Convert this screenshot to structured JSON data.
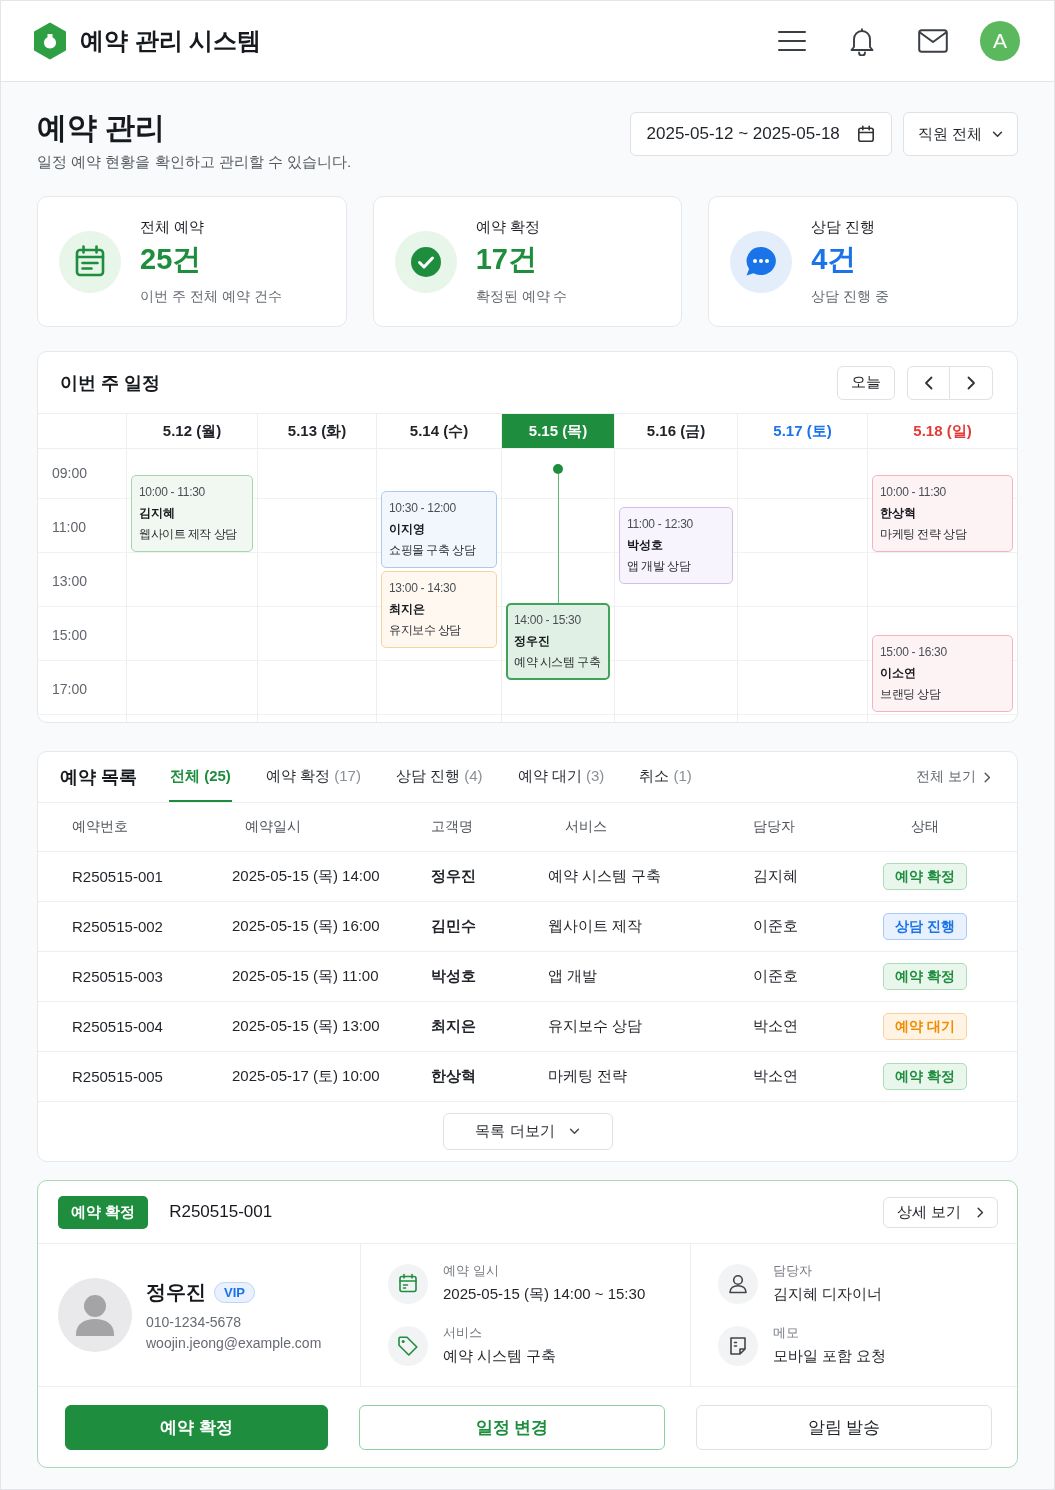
{
  "header": {
    "title": "예약 관리 시스템",
    "user_initial": "A"
  },
  "page": {
    "title": "예약 관리",
    "subtitle": "일정 예약 현황을 확인하고 관리할 수 있습니다.",
    "date_range": "2025-05-12 ~ 2025-05-18",
    "staff_filter": "직원 전체"
  },
  "stats": [
    {
      "kind": "total",
      "label": "전체 예약",
      "value": "25건",
      "description": "이번 주 전체 예약 건수"
    },
    {
      "kind": "confirmed",
      "label": "예약 확정",
      "value": "17건",
      "description": "확정된 예약 수"
    },
    {
      "kind": "consulting",
      "label": "상담 진행",
      "value": "4건",
      "description": "상담 진행 중"
    }
  ],
  "schedule": {
    "title": "이번 주 일정",
    "today_button": "오늘",
    "times": [
      "09:00",
      "11:00",
      "13:00",
      "15:00",
      "17:00"
    ],
    "days": [
      {
        "label": "5.12 (월)",
        "kind": "weekday",
        "selected": false,
        "events": [
          {
            "time": "10:00 - 11:30",
            "name": "김지혜",
            "service": "웹사이트 제작 상담",
            "color": "#a5d6a7",
            "selected": false
          }
        ]
      },
      {
        "label": "5.13 (화)",
        "kind": "weekday",
        "selected": false
      },
      {
        "label": "5.14 (수)",
        "kind": "weekday",
        "selected": false,
        "events": [
          {
            "time": "10:30 - 12:00",
            "name": "이지영",
            "service": "쇼핑몰 구축 상담",
            "color": "#a9cbf0",
            "selected": false
          },
          {
            "time": "13:00 - 14:30",
            "name": "최지은",
            "service": "유지보수 상담",
            "color": "#f8d3a0",
            "selected": false
          }
        ]
      },
      {
        "label": "5.15 (목)",
        "kind": "weekday",
        "selected": true,
        "events": [
          {
            "time": "14:00 - 15:30",
            "name": "정우진",
            "service": "예약 시스템 구축",
            "color": "#3fa35a",
            "selected": true
          }
        ]
      },
      {
        "label": "5.16 (금)",
        "kind": "weekday",
        "selected": false,
        "events": [
          {
            "time": "11:00 - 12:30",
            "name": "박성호",
            "service": "앱 개발 상담",
            "color": "#d2bdf2",
            "selected": false
          }
        ]
      },
      {
        "label": "5.17 (토)",
        "kind": "saturday",
        "selected": false
      },
      {
        "label": "5.18 (일)",
        "kind": "sunday",
        "selected": false,
        "events": [
          {
            "time": "10:00 - 11:30",
            "name": "한상혁",
            "service": "마케팅 전략 상담",
            "color": "#f4b3c2",
            "selected": false
          },
          {
            "time": "15:00 - 16:30",
            "name": "이소연",
            "service": "브랜딩 상담",
            "color": "#f4b3c2",
            "selected": false
          }
        ]
      }
    ]
  },
  "reservations": {
    "title": "예약 목록",
    "tabs": [
      {
        "label": "전체",
        "count": "(25)",
        "selected": true
      },
      {
        "label": "예약 확정",
        "count": "(17)",
        "selected": false
      },
      {
        "label": "상담 진행",
        "count": "(4)",
        "selected": false
      },
      {
        "label": "예약 대기",
        "count": "(3)",
        "selected": false
      },
      {
        "label": "취소",
        "count": "(1)",
        "selected": false
      }
    ],
    "view_all": "전체 보기",
    "columns": [
      "예약번호",
      "예약일시",
      "고객명",
      "서비스",
      "담당자",
      "상태"
    ],
    "rows": [
      {
        "id": "R250515-001",
        "datetime": "2025-05-15 (목) 14:00",
        "customer": "정우진",
        "service": "예약 시스템 구축",
        "staff": "김지혜",
        "status": {
          "label": "예약 확정",
          "kind": "confirmed"
        }
      },
      {
        "id": "R250515-002",
        "datetime": "2025-05-15 (목) 16:00",
        "customer": "김민수",
        "service": "웹사이트 제작",
        "staff": "이준호",
        "status": {
          "label": "상담 진행",
          "kind": "consulting"
        }
      },
      {
        "id": "R250515-003",
        "datetime": "2025-05-15 (목) 11:00",
        "customer": "박성호",
        "service": "앱 개발",
        "staff": "이준호",
        "status": {
          "label": "예약 확정",
          "kind": "confirmed"
        }
      },
      {
        "id": "R250515-004",
        "datetime": "2025-05-15 (목) 13:00",
        "customer": "최지은",
        "service": "유지보수 상담",
        "staff": "박소연",
        "status": {
          "label": "예약 대기",
          "kind": "waiting"
        }
      },
      {
        "id": "R250515-005",
        "datetime": "2025-05-17 (토) 10:00",
        "customer": "한상혁",
        "service": "마케팅 전략",
        "staff": "박소연",
        "status": {
          "label": "예약 확정",
          "kind": "confirmed"
        }
      }
    ],
    "more_button": "목록 더보기"
  },
  "detail": {
    "status": {
      "label": "예약 확정",
      "kind": "confirmed"
    },
    "id": "R250515-001",
    "more_button": "상세 보기",
    "customer": {
      "name": "정우진",
      "tag": "VIP",
      "phone": "010-1234-5678",
      "email": "woojin.jeong@example.com"
    },
    "info_columns": [
      {
        "fields": [
          {
            "kind": "datetime",
            "label": "예약 일시",
            "value": "2025-05-15 (목) 14:00 ~ 15:30"
          },
          {
            "kind": "service",
            "label": "서비스",
            "value": "예약 시스템 구축"
          }
        ]
      },
      {
        "fields": [
          {
            "kind": "staff",
            "label": "담당자",
            "value": "김지혜 디자이너"
          },
          {
            "kind": "memo",
            "label": "메모",
            "value": "모바일 포함 요청"
          }
        ]
      }
    ],
    "actions": [
      {
        "label": "예약 확정",
        "kind": "primary"
      },
      {
        "label": "일정 변경",
        "kind": "outline"
      },
      {
        "label": "알림 발송",
        "kind": "default"
      }
    ]
  }
}
